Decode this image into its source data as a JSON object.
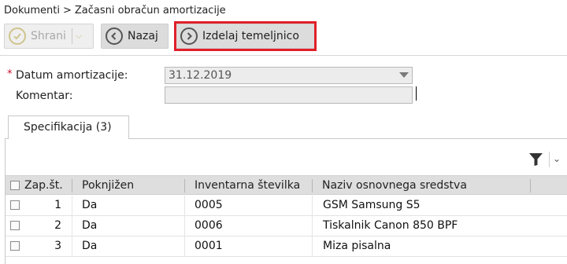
{
  "breadcrumb": {
    "parent": "Dokumenti",
    "separator": ">",
    "current": "Začasni obračun amortizacije"
  },
  "toolbar": {
    "save_label": "Shrani",
    "back_label": "Nazaj",
    "posting_label": "Izdelaj temeljnico"
  },
  "form": {
    "required_mark": "*",
    "date_label": "Datum amortizacije:",
    "date_value": "31.12.2019",
    "comment_label": "Komentar:",
    "comment_value": ""
  },
  "tabs": [
    {
      "label": "Specifikacija (3)"
    }
  ],
  "table": {
    "headers": {
      "seq": "Zap.št.",
      "posted": "Poknjižen",
      "inventory": "Inventarna številka",
      "asset": "Naziv osnovnega sredstva"
    },
    "rows": [
      {
        "seq": "1",
        "posted": "Da",
        "inventory": "0005",
        "asset": "GSM Samsung S5"
      },
      {
        "seq": "2",
        "posted": "Da",
        "inventory": "0006",
        "asset": "Tiskalnik Canon 850 BPF"
      },
      {
        "seq": "3",
        "posted": "Da",
        "inventory": "0001",
        "asset": "Miza pisalna"
      }
    ]
  },
  "icons": {
    "save": "check-circle-icon",
    "back": "arrow-left-circle-icon",
    "posting": "arrow-right-circle-icon",
    "filter": "filter-icon"
  },
  "colors": {
    "highlight": "#e0202a",
    "toolbar_button": "#dcdcdc",
    "header_row": "#dedede"
  }
}
